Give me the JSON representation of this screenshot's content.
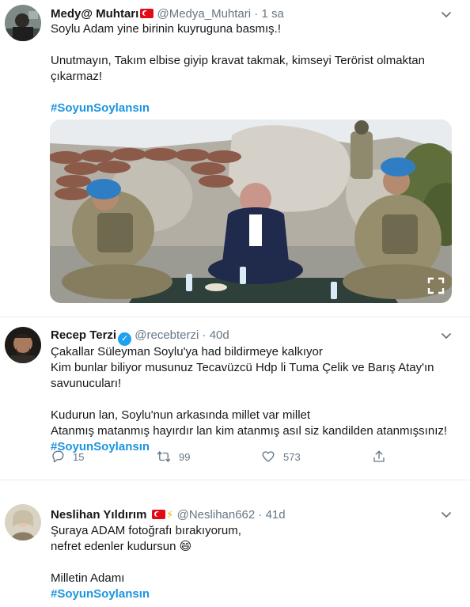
{
  "tweets": [
    {
      "name": "Medy@ Muhtarı",
      "handle": "@Medya_Muhtari",
      "dot": "·",
      "time": "1 sa",
      "lines": [
        "Soylu Adam yine birinin kuyruguna basmış.!",
        "",
        "Unutmayın, Takım elbise giyip kravat takmak, kimseyi Terörist olmaktan",
        "çıkarmaz!",
        ""
      ],
      "hashtag": "#SoyunSoylansın"
    },
    {
      "name": "Recep Terzi",
      "handle": "@recebterzi",
      "dot": "·",
      "time": "40d",
      "lines": [
        "Çakallar Süleyman Soylu'ya had bildirmeye kalkıyor",
        "Kim bunlar biliyor musunuz Tecavüzcü Hdp li Tuma Çelik ve Barış Atay'ın",
        "savunucuları!",
        "",
        "Kudurun lan, Soylu'nun arkasında millet var millet",
        "Atanmış matanmış hayırdır lan kim atanmış asıl siz kandilden atanmışsınız!"
      ],
      "hashtag": "#SoyunSoylansın",
      "actions": {
        "replies": "15",
        "retweets": "99",
        "likes": "573"
      }
    },
    {
      "name": "Neslihan Yıldırım",
      "handle": "@Neslihan662",
      "dot": "·",
      "time": "41d",
      "lines": [
        "Şuraya ADAM fotoğrafı bırakıyorum,",
        "nefret edenler kudursun 😄",
        "",
        "Milletin Adamı"
      ],
      "hashtag": "#SoyunSoylansın"
    }
  ],
  "icons": {
    "more": "chevron-down-icon",
    "reply": "reply-icon",
    "retweet": "retweet-icon",
    "like": "heart-icon",
    "share": "share-icon",
    "expand": "expand-icon",
    "verified": "verified-badge-icon"
  },
  "colors": {
    "accent": "#1b95e0",
    "muted": "#657786",
    "verified": "#1da1f2",
    "flag": "#e30a17"
  }
}
